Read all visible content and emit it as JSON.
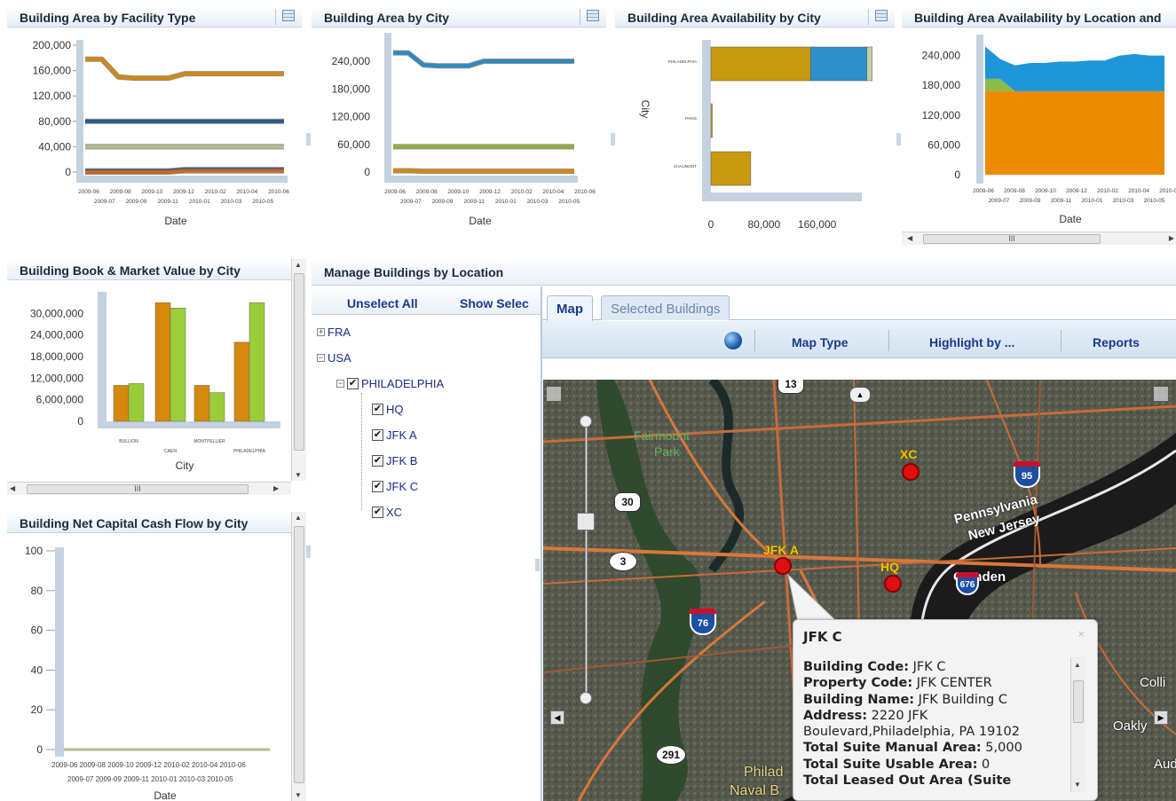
{
  "panels": {
    "facility": {
      "title": "Building Area by Facility Type",
      "xlabel": "Date",
      "y_ticks": [
        "200,000",
        "160,000",
        "120,000",
        "80,000",
        "40,000",
        "0"
      ]
    },
    "city": {
      "title": "Building Area by City",
      "xlabel": "Date",
      "y_ticks": [
        "240,000",
        "180,000",
        "120,000",
        "60,000",
        "0"
      ]
    },
    "avail_city": {
      "title": "Building Area Availability by City",
      "ylabel": "City",
      "x_ticks": [
        "0",
        "80,000",
        "160,000"
      ],
      "y_cats": [
        "PHILADELPHIA",
        "PARIS",
        "CHAUMONT"
      ]
    },
    "avail_loc": {
      "title": "Building Area Availability by Location and",
      "xlabel": "Date",
      "y_ticks": [
        "240,000",
        "180,000",
        "120,000",
        "60,000",
        "0"
      ]
    },
    "bookvalue": {
      "title": "Building Book & Market Value by City",
      "xlabel": "City",
      "y_ticks": [
        "30,000,000",
        "24,000,000",
        "18,000,000",
        "12,000,000",
        "6,000,000",
        "0"
      ],
      "x_cats": [
        "BULLION",
        "CAEN",
        "MONTPELLIER",
        "PHILADELPHIA"
      ]
    },
    "cashflow": {
      "title": "Building Net Capital Cash Flow by City",
      "xlabel": "Date",
      "y_ticks": [
        "100",
        "80",
        "60",
        "40",
        "20",
        "0"
      ],
      "date_row1": "2009-06 2009-08 2009-10 2009-12 2010-02 2010-04 2010-06",
      "date_row2": "2009-07 2009-09 2009-11 2010-01 2010-03 2010-05"
    }
  },
  "date_ticks_top": [
    "2009-06",
    "2009-08",
    "2009-10",
    "2009-12",
    "2010-02",
    "2010-04",
    "2010-06"
  ],
  "date_ticks_bottom": [
    "2009-07",
    "2009-09",
    "2009-11",
    "2010-01",
    "2010-03",
    "2010-05"
  ],
  "scroll_thumb_label": "III",
  "manage": {
    "title": "Manage Buildings by Location",
    "unselect_all": "Unselect All",
    "show_selected": "Show Selec",
    "tree": {
      "fra": "FRA",
      "usa": "USA",
      "philadelphia": "PHILADELPHIA",
      "buildings": [
        "HQ",
        "JFK A",
        "JFK B",
        "JFK C",
        "XC"
      ]
    },
    "tabs": {
      "map": "Map",
      "selected": "Selected Buildings"
    },
    "toolbar": {
      "map_type": "Map Type",
      "highlight": "Highlight by ...",
      "reports": "Reports"
    }
  },
  "map": {
    "labels": {
      "fairmount": "Fairmount",
      "park": "Park",
      "pennsylvania": "Pennsylvania",
      "new_jersey": "New Jersey",
      "camden": "Camden",
      "phila": "Philad",
      "naval": "Naval B",
      "colli": "Colli",
      "oakly": "Oakly",
      "aud": "Aud"
    },
    "routes": {
      "r13": "13",
      "r30": "30",
      "r3": "3",
      "r291": "291",
      "i95": "95",
      "i76": "76",
      "i676": "676"
    },
    "markers": {
      "xc": "XC",
      "jfka": "JFK A",
      "hq": "HQ"
    }
  },
  "popup": {
    "title": "JFK C",
    "close": "×",
    "lines": [
      {
        "k": "Building Code:",
        "v": " JFK C"
      },
      {
        "k": "Property Code:",
        "v": " JFK CENTER"
      },
      {
        "k": "Building Name:",
        "v": " JFK Building C"
      },
      {
        "k": "Address:",
        "v": " 2220 JFK"
      },
      {
        "k": "",
        "v": "Boulevard,Philadelphia, PA 19102"
      },
      {
        "k": "Total Suite Manual Area:",
        "v": " 5,000"
      },
      {
        "k": "Total Suite Usable Area:",
        "v": " 0"
      },
      {
        "k": "Total Leased Out Area (Suite",
        "v": ""
      }
    ]
  },
  "chart_data": [
    {
      "type": "line",
      "title": "Building Area by Facility Type",
      "xlabel": "Date",
      "x": [
        "2009-06",
        "2009-07",
        "2009-08",
        "2009-09",
        "2009-10",
        "2009-11",
        "2009-12",
        "2010-01",
        "2010-02",
        "2010-03",
        "2010-04",
        "2010-05",
        "2010-06"
      ],
      "series": [
        {
          "color": "#d4880c",
          "values": [
            178000,
            178000,
            150000,
            148000,
            148000,
            148000,
            155000,
            155000,
            155000,
            155000,
            155000,
            155000,
            155000
          ]
        },
        {
          "color": "#2a5a86",
          "values": [
            80000,
            80000,
            80000,
            80000,
            80000,
            80000,
            80000,
            80000,
            80000,
            80000,
            80000,
            80000,
            80000
          ]
        },
        {
          "color": "#b6bc8a",
          "values": [
            40000,
            40000,
            40000,
            40000,
            40000,
            40000,
            40000,
            40000,
            40000,
            40000,
            40000,
            40000,
            40000
          ]
        },
        {
          "color": "#3a6a9a",
          "values": [
            2000,
            2000,
            2000,
            2000,
            2000,
            2000,
            4000,
            4000,
            4000,
            4000,
            4000,
            4000,
            4000
          ]
        },
        {
          "color": "#c56a2a",
          "values": [
            0,
            0,
            0,
            0,
            0,
            0,
            2000,
            2000,
            2000,
            2000,
            2000,
            2000,
            2000
          ]
        }
      ]
    },
    {
      "type": "line",
      "title": "Building Area by City",
      "xlabel": "Date",
      "x": [
        "2009-06",
        "2009-07",
        "2009-08",
        "2009-09",
        "2009-10",
        "2009-11",
        "2009-12",
        "2010-01",
        "2010-02",
        "2010-03",
        "2010-04",
        "2010-05",
        "2010-06"
      ],
      "series": [
        {
          "color": "#2a8ac4",
          "values": [
            258000,
            258000,
            232000,
            230000,
            230000,
            230000,
            240000,
            240000,
            240000,
            240000,
            240000,
            240000,
            240000
          ]
        },
        {
          "color": "#8fae3a",
          "values": [
            55000,
            55000,
            55000,
            55000,
            55000,
            55000,
            55000,
            55000,
            55000,
            55000,
            55000,
            55000,
            55000
          ]
        },
        {
          "color": "#d4880c",
          "values": [
            3000,
            3000,
            2000,
            2000,
            2000,
            2000,
            2000,
            2000,
            2000,
            2000,
            2000,
            2000,
            2000
          ]
        }
      ]
    },
    {
      "type": "bar",
      "orientation": "horizontal",
      "title": "Building Area Availability by City",
      "ylabel": "City",
      "categories": [
        "PHILADELPHIA",
        "PARIS",
        "CHAUMONT"
      ],
      "series": [
        {
          "color": "#c89a10",
          "values": [
            150000,
            2000,
            60000
          ]
        },
        {
          "color": "#2e90c8",
          "values": [
            85000,
            0,
            0
          ]
        },
        {
          "color": "#c8d0a0",
          "values": [
            8000,
            0,
            0
          ]
        }
      ],
      "xlim": [
        0,
        230000
      ]
    },
    {
      "type": "area",
      "title": "Building Area Availability by Location and",
      "xlabel": "Date",
      "x": [
        "2009-06",
        "2009-07",
        "2009-08",
        "2009-09",
        "2009-10",
        "2009-11",
        "2009-12",
        "2010-01",
        "2010-02",
        "2010-03",
        "2010-04",
        "2010-05",
        "2010-06"
      ],
      "series": [
        {
          "color": "#ec8a00",
          "values": [
            168000,
            168000,
            168000,
            168000,
            168000,
            168000,
            168000,
            168000,
            168000,
            168000,
            168000,
            168000,
            168000
          ]
        },
        {
          "color": "#8dba48",
          "values": [
            25000,
            25000,
            0,
            0,
            0,
            0,
            0,
            0,
            0,
            0,
            0,
            0,
            0
          ]
        },
        {
          "color": "#1e96d8",
          "values": [
            65000,
            40000,
            52000,
            57000,
            57000,
            60000,
            60000,
            62000,
            62000,
            72000,
            75000,
            72000,
            72000
          ]
        }
      ]
    },
    {
      "type": "bar",
      "title": "Building Book & Market Value by City",
      "xlabel": "City",
      "categories": [
        "BULLION",
        "CAEN",
        "MONTPELLIER",
        "PHILADELPHIA"
      ],
      "series": [
        {
          "color": "#d4880c",
          "values": [
            10000000,
            33000000,
            10000000,
            22000000
          ]
        },
        {
          "color": "#9bcd3a",
          "values": [
            10500000,
            31500000,
            8000000,
            33000000
          ]
        }
      ],
      "ylim": [
        0,
        30000000
      ]
    },
    {
      "type": "line",
      "title": "Building Net Capital Cash Flow by City",
      "xlabel": "Date",
      "x": [
        "2009-06",
        "2009-07",
        "2009-08",
        "2009-09",
        "2009-10",
        "2009-11",
        "2009-12",
        "2010-01",
        "2010-02",
        "2010-03",
        "2010-04",
        "2010-05",
        "2010-06"
      ],
      "series": [
        {
          "color": "#b6bc8a",
          "values": [
            0,
            0,
            0,
            0,
            0,
            0,
            0,
            0,
            0,
            0,
            0,
            0,
            0
          ]
        }
      ],
      "ylim": [
        0,
        100
      ]
    }
  ]
}
